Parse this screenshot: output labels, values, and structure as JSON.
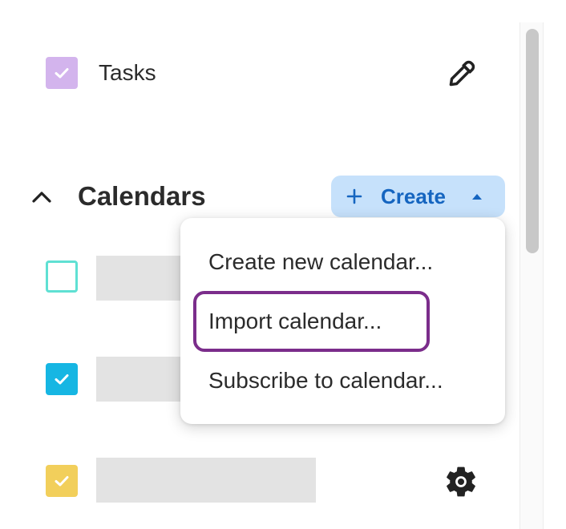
{
  "tasks": {
    "label": "Tasks",
    "checked": true,
    "color": "#d3b4ed",
    "action_icon": "eyedropper-icon"
  },
  "calendars": {
    "title": "Calendars",
    "expanded": true,
    "collapse_icon": "chevron-up-icon",
    "create_button": {
      "label": "Create",
      "icon": "plus-icon",
      "caret_icon": "caret-up-icon",
      "color": "#c6e1fb",
      "text_color": "#1565c0"
    },
    "items": [
      {
        "checked": false,
        "color": "#5fe0d3"
      },
      {
        "checked": true,
        "color": "#16b6e3"
      },
      {
        "checked": true,
        "color": "#f2cf5b",
        "action_icon": "gear-icon"
      }
    ]
  },
  "create_menu": {
    "items": [
      {
        "label": "Create new calendar..."
      },
      {
        "label": "Import calendar...",
        "focused": true
      },
      {
        "label": "Subscribe to calendar..."
      }
    ],
    "focus_color": "#7b2d8b"
  }
}
